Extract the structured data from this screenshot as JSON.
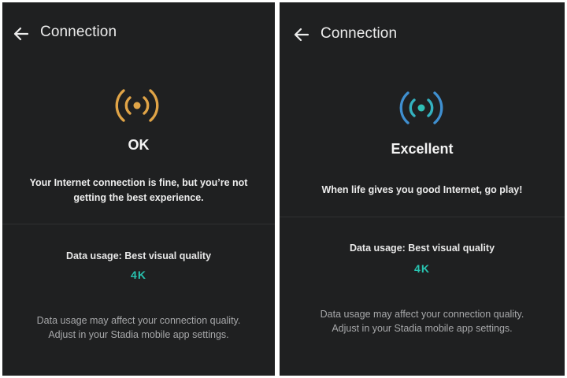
{
  "colors": {
    "panel_background": "#1f2021",
    "ok_signal": "#e0a447",
    "excellent_signal_center": "#2fbfb5",
    "excellent_signal_outer": "#3f8fd0",
    "quality_accent": "#28c3b0"
  },
  "panels": [
    {
      "header": {
        "back_icon": "arrow-back-icon",
        "title": "Connection"
      },
      "status": {
        "icon": "signal-broadcast-icon",
        "label": "OK"
      },
      "message": [
        "Your Internet connection is fine, but you’re not",
        "getting the best experience."
      ],
      "data_usage": {
        "label": "Data usage: Best visual quality",
        "quality": "4K"
      },
      "note": [
        "Data usage may affect your connection quality.",
        "Adjust in your Stadia mobile app settings."
      ]
    },
    {
      "header": {
        "back_icon": "arrow-back-icon",
        "title": "Connection"
      },
      "status": {
        "icon": "signal-broadcast-icon",
        "label": "Excellent"
      },
      "message": [
        "When life gives you good Internet, go play!"
      ],
      "data_usage": {
        "label": "Data usage: Best visual quality",
        "quality": "4K"
      },
      "note": [
        "Data usage may affect your connection quality.",
        "Adjust in your Stadia mobile app settings."
      ]
    }
  ]
}
